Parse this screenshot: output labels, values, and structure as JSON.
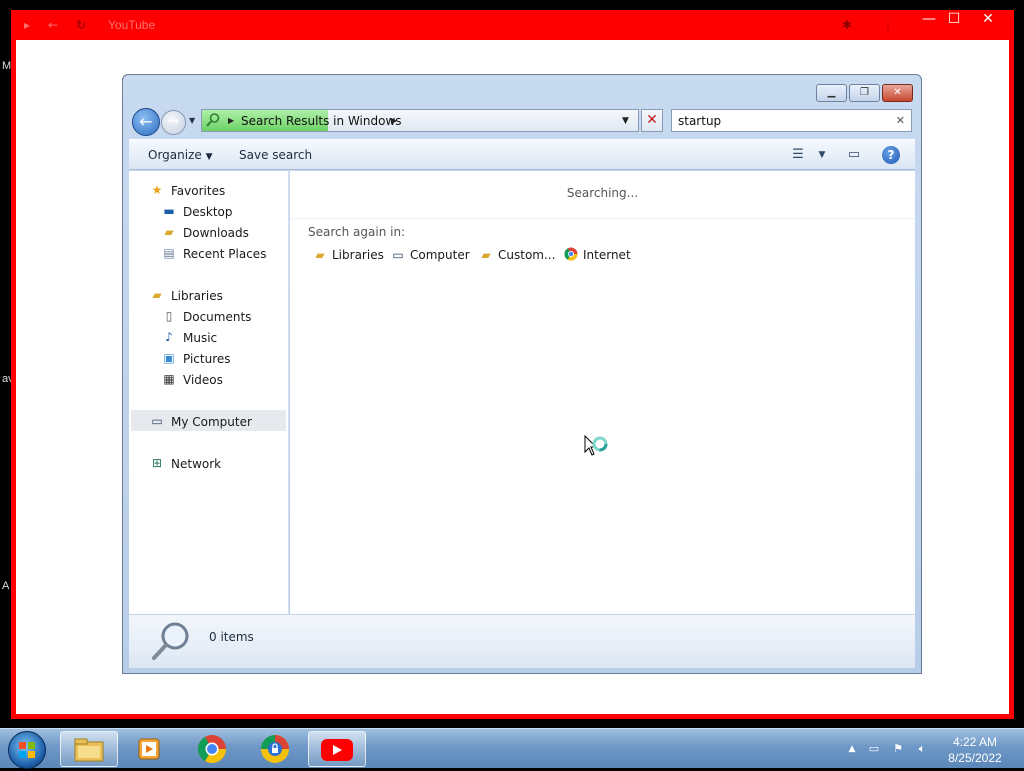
{
  "desktop": {
    "edge_fragments": [
      "M",
      "av",
      "A"
    ]
  },
  "browser": {
    "title": "YouTube",
    "controls": {
      "minimize": "—",
      "maximize": "☐",
      "close": "✕"
    },
    "accent_color": "#ff0000"
  },
  "explorer": {
    "address": {
      "text": "Search Results in Windows",
      "progress": 0.29
    },
    "search": {
      "value": "startup"
    },
    "toolbar": {
      "organize_label": "Organize",
      "save_search_label": "Save search"
    },
    "navpane": {
      "favorites": {
        "label": "Favorites",
        "items": [
          "Desktop",
          "Downloads",
          "Recent Places"
        ]
      },
      "libraries": {
        "label": "Libraries",
        "items": [
          "Documents",
          "Music",
          "Pictures",
          "Videos"
        ]
      },
      "my_computer": "My Computer",
      "network": "Network"
    },
    "content": {
      "status": "Searching...",
      "search_again_label": "Search again in:",
      "search_again_items": [
        "Libraries",
        "Computer",
        "Custom...",
        "Internet"
      ]
    },
    "details": {
      "items_count": "0 items"
    }
  },
  "taskbar": {
    "clock_time": "4:22 AM",
    "clock_date": "8/25/2022"
  }
}
